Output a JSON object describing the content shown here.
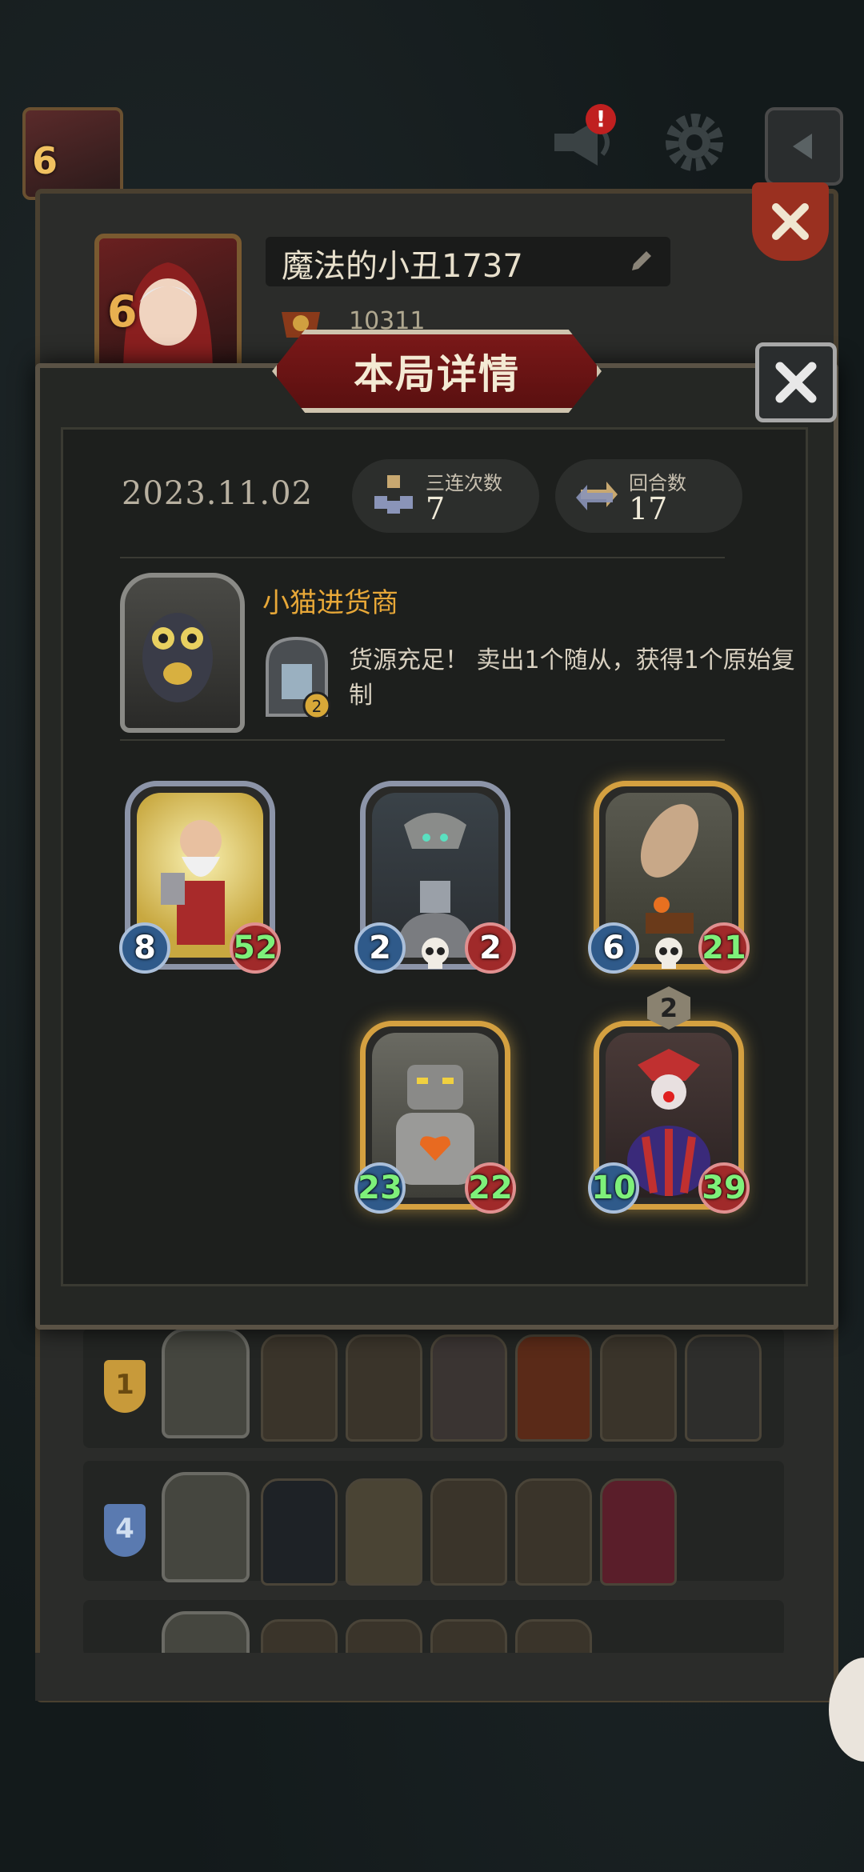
{
  "top_bar": {
    "player_level": "6",
    "notification_badge": "!"
  },
  "profile": {
    "level": "6",
    "name": "魔法的小丑1737",
    "score": "10311"
  },
  "modal": {
    "title": "本局详情",
    "date": "2023.11.02",
    "stats": [
      {
        "label": "三连次数",
        "value": "7",
        "icon": "triple-icon"
      },
      {
        "label": "回合数",
        "value": "17",
        "icon": "round-icon"
      }
    ],
    "hero": {
      "name": "小猫进货商",
      "skill_level": "2",
      "skill_text": "货源充足！ 卖出1个随从，获得1个原始复制"
    },
    "cards": [
      {
        "name": "old-warrior",
        "attack": "8",
        "health": "52",
        "frame": "silver",
        "atk_buffed": false,
        "hp_buffed": true,
        "skull": false
      },
      {
        "name": "bell-robot",
        "attack": "2",
        "health": "2",
        "frame": "silver",
        "atk_buffed": false,
        "hp_buffed": false,
        "skull": true
      },
      {
        "name": "airship",
        "attack": "6",
        "health": "21",
        "frame": "gold",
        "atk_buffed": false,
        "hp_buffed": true,
        "skull": true
      },
      {
        "name": "heart-robot",
        "attack": "23",
        "health": "22",
        "frame": "gold",
        "atk_buffed": true,
        "hp_buffed": true,
        "skull": false
      },
      {
        "name": "clown",
        "attack": "10",
        "health": "39",
        "frame": "gold",
        "atk_buffed": true,
        "hp_buffed": true,
        "skull": false,
        "level": "2"
      }
    ]
  },
  "history": [
    {
      "rank": "1",
      "color": "#c89a3a"
    },
    {
      "rank": "4",
      "color": "#5a7ab0"
    }
  ],
  "colors": {
    "accent_gold": "#e8a838",
    "banner_red": "#7a1818",
    "buff_green": "#7ef07a"
  }
}
